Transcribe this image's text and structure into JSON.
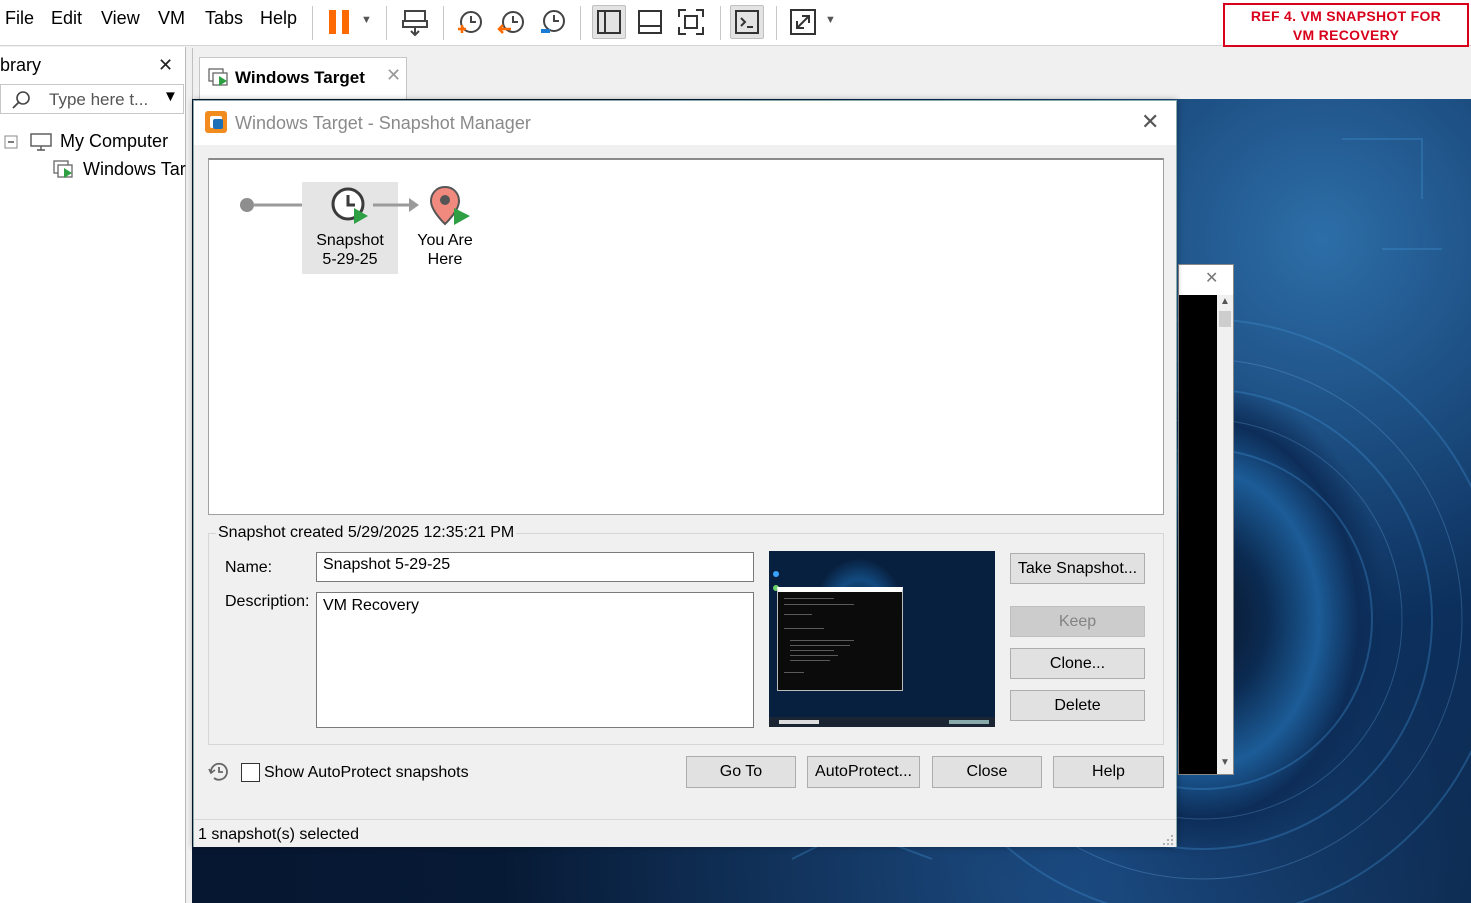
{
  "menubar": {
    "items": [
      "File",
      "Edit",
      "View",
      "VM",
      "Tabs",
      "Help"
    ]
  },
  "toolbar": {
    "icons": [
      "pause-icon",
      "send-ctrl-alt-del-icon",
      "take-snapshot-icon",
      "revert-snapshot-icon",
      "snapshot-manager-icon",
      "show-library-icon",
      "thumbnail-bar-icon",
      "full-screen-icon",
      "console-view-icon",
      "stretch-guest-icon"
    ],
    "accent_color": "#ff6a00"
  },
  "annotation": {
    "line1": "REF 4. VM SNAPSHOT FOR",
    "line2": "VM RECOVERY",
    "color": "#d9001b"
  },
  "library": {
    "title": "ibrary",
    "search_placeholder": "Type here t...",
    "tree": {
      "root": "My Computer",
      "child": "Windows Tar"
    }
  },
  "tabs": [
    {
      "label": "Windows Target",
      "active": true
    }
  ],
  "dialog": {
    "title": "Windows Target - Snapshot Manager",
    "snapshot_tree": {
      "snapshot_label_line1": "Snapshot",
      "snapshot_label_line2": "5-29-25",
      "you_are_here_line1": "You Are",
      "you_are_here_line2": "Here"
    },
    "details": {
      "created": "Snapshot created 5/29/2025 12:35:21 PM",
      "name_label": "Name:",
      "name_value": "Snapshot 5-29-25",
      "description_label": "Description:",
      "description_value": "VM Recovery"
    },
    "buttons": {
      "take_snapshot": "Take Snapshot...",
      "keep": "Keep",
      "clone": "Clone...",
      "delete": "Delete",
      "go_to": "Go To",
      "autoprotect": "AutoProtect...",
      "close": "Close",
      "help": "Help"
    },
    "show_autoprotect": {
      "label": "Show AutoProtect snapshots",
      "checked": false
    },
    "status": "1 snapshot(s) selected"
  }
}
